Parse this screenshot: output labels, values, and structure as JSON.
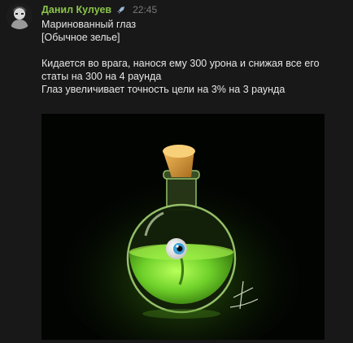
{
  "message": {
    "author": "Данил Кулуев",
    "badge_icon": "rocket-icon",
    "time": "22:45",
    "lines": [
      "Маринованный глаз",
      "[Обычное зелье]",
      "",
      "Кидается во врага, нанося ему 300 урона и снижая все его",
      "статы на 300 на 4 раунда",
      "Глаз увеличивает точность цели на 3% на 3 раунда"
    ]
  },
  "colors": {
    "background": "#181818",
    "author": "#8bc34a",
    "text": "#e6e6e6",
    "time": "#7a7a7a",
    "potion_liquid": "#6fd12a"
  }
}
